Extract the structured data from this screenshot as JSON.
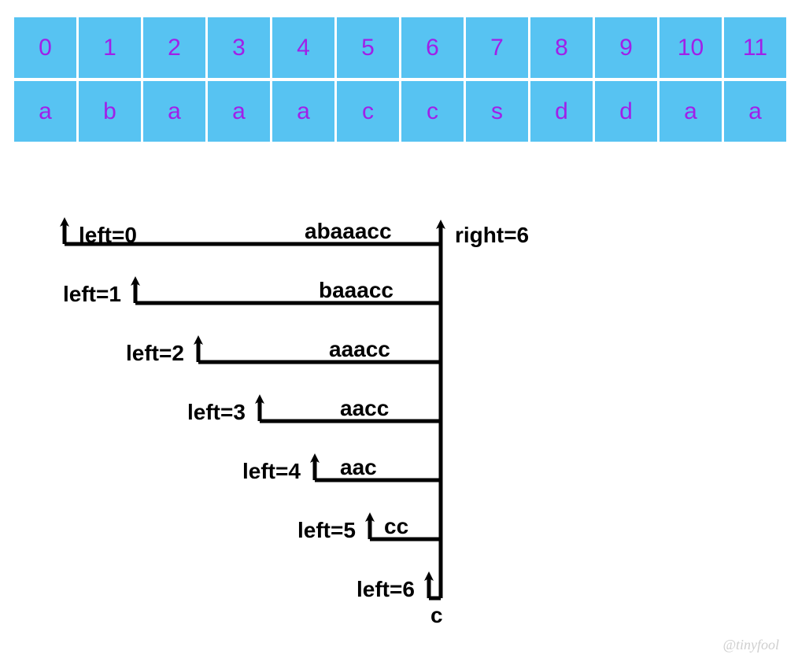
{
  "table": {
    "indices": [
      "0",
      "1",
      "2",
      "3",
      "4",
      "5",
      "6",
      "7",
      "8",
      "9",
      "10",
      "11"
    ],
    "chars": [
      "a",
      "b",
      "a",
      "a",
      "a",
      "c",
      "c",
      "s",
      "d",
      "d",
      "a",
      "a"
    ]
  },
  "diagram": {
    "right_label": "right=6",
    "bottom_char": "c",
    "levels": [
      {
        "left_label": "left=0",
        "substr": "abaaacc"
      },
      {
        "left_label": "left=1",
        "substr": "baaacc"
      },
      {
        "left_label": "left=2",
        "substr": "aaacc"
      },
      {
        "left_label": "left=3",
        "substr": "aacc"
      },
      {
        "left_label": "left=4",
        "substr": "aac"
      },
      {
        "left_label": "left=5",
        "substr": "cc"
      },
      {
        "left_label": "left=6",
        "substr": ""
      }
    ]
  },
  "watermark": "@tinyfool"
}
